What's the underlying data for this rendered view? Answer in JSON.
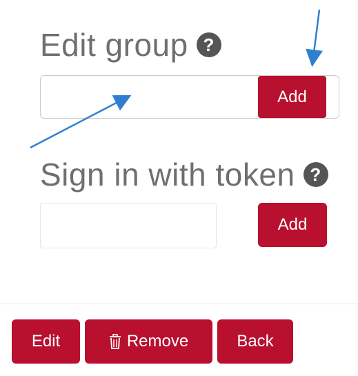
{
  "edit_group": {
    "heading": "Edit group",
    "help_icon": "question-circle-icon",
    "input_value": "",
    "add_label": "Add"
  },
  "sign_in_token": {
    "heading": "Sign in with token",
    "help_icon": "question-circle-icon",
    "input_value": "",
    "add_label": "Add"
  },
  "actions": {
    "edit_label": "Edit",
    "remove_label": "Remove",
    "remove_icon": "trash-icon",
    "back_label": "Back"
  },
  "colors": {
    "primary": "#b8102e",
    "heading": "#6f6f6f",
    "annotation_arrow": "#2f7fd0"
  }
}
